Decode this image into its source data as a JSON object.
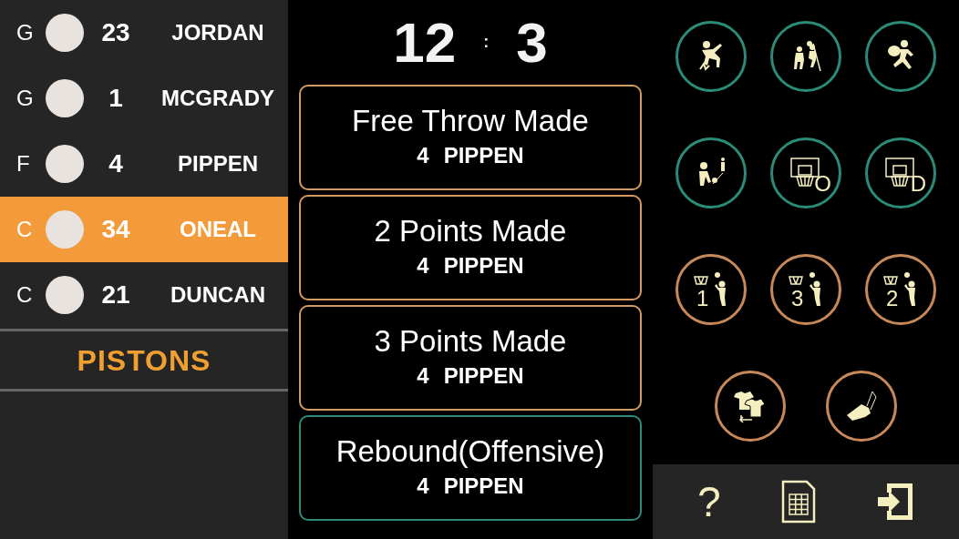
{
  "roster": [
    {
      "position": "G",
      "number": "23",
      "name": "JORDAN",
      "selected": false
    },
    {
      "position": "G",
      "number": "1",
      "name": "MCGRADY",
      "selected": false
    },
    {
      "position": "F",
      "number": "4",
      "name": "PIPPEN",
      "selected": false
    },
    {
      "position": "C",
      "number": "34",
      "name": "ONEAL",
      "selected": true
    },
    {
      "position": "C",
      "number": "21",
      "name": "DUNCAN",
      "selected": false
    }
  ],
  "team": "PISTONS",
  "score": {
    "home": "12",
    "separator": ":",
    "away": "3"
  },
  "events": [
    {
      "title": "Free Throw Made",
      "number": "4",
      "player": "PIPPEN",
      "color": "#d39a62"
    },
    {
      "title": "2 Points Made",
      "number": "4",
      "player": "PIPPEN",
      "color": "#d39a62"
    },
    {
      "title": "3 Points Made",
      "number": "4",
      "player": "PIPPEN",
      "color": "#d39a62"
    },
    {
      "title": "Rebound(Offensive)",
      "number": "4",
      "player": "PIPPEN",
      "color": "#2b8a78"
    }
  ],
  "actions": [
    [
      {
        "kind": "fall",
        "color": "#2b8a78"
      },
      {
        "kind": "block",
        "color": "#2b8a78"
      },
      {
        "kind": "steal",
        "color": "#2b8a78"
      }
    ],
    [
      {
        "kind": "kick",
        "color": "#2b8a78"
      },
      {
        "kind": "rebound",
        "label": "O",
        "color": "#2b8a78"
      },
      {
        "kind": "rebound",
        "label": "D",
        "color": "#2b8a78"
      }
    ],
    [
      {
        "kind": "shot",
        "label": "1",
        "color": "#c8895a"
      },
      {
        "kind": "shot",
        "label": "3",
        "color": "#c8895a"
      },
      {
        "kind": "shot",
        "label": "2",
        "color": "#c8895a"
      }
    ],
    [
      {
        "kind": "substitute",
        "color": "#c8895a"
      },
      {
        "kind": "whistle",
        "color": "#c8895a"
      }
    ]
  ],
  "bottom_bar": {
    "help": "?"
  }
}
